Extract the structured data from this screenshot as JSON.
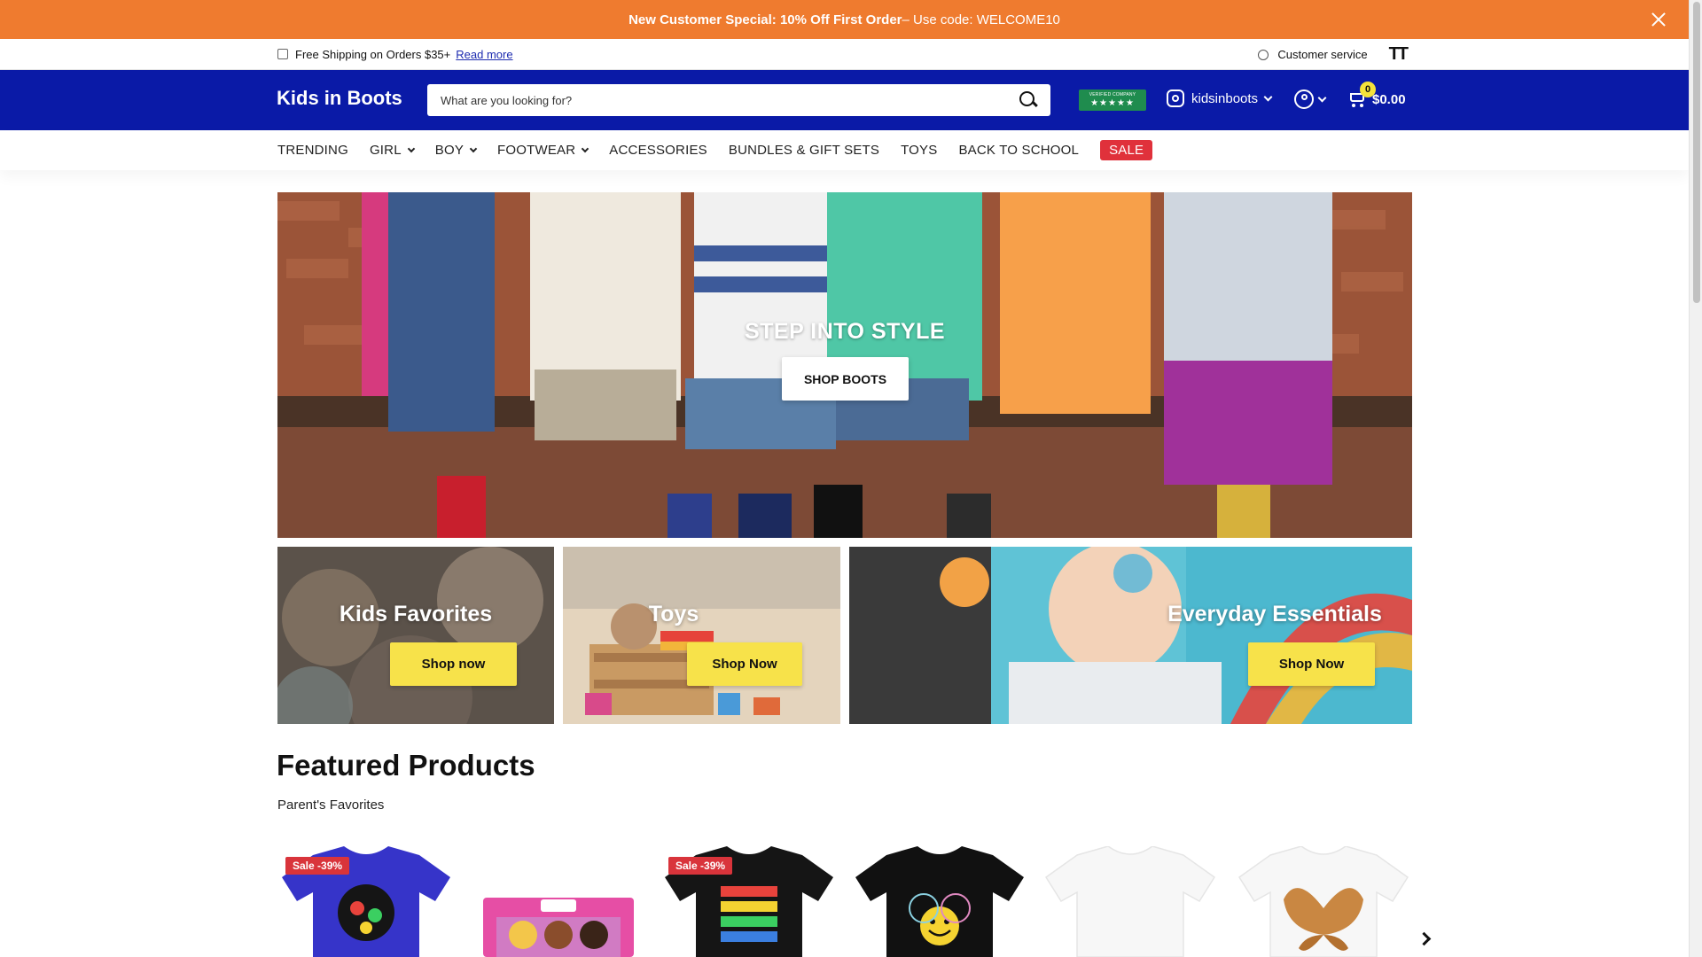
{
  "promo": {
    "bold_text": "New Customer Special: 10% Off First Order",
    "rest_text": "– Use code: WELCOME10"
  },
  "utility": {
    "shipping_text": "Free Shipping on Orders $35+",
    "read_more": "Read more",
    "customer_service": "Customer service",
    "text_size_label": "TT"
  },
  "header": {
    "logo": "Kids in Boots",
    "search_placeholder": "What are you looking for?",
    "trust_badge_top": "VERIFIED COMPANY",
    "trust_badge_stars": "★★★★★",
    "instagram_handle": "kidsinboots",
    "cart_count": "0",
    "cart_total": "$0.00"
  },
  "nav": {
    "items": [
      {
        "label": "TRENDING"
      },
      {
        "label": "GIRL"
      },
      {
        "label": "BOY"
      },
      {
        "label": "FOOTWEAR"
      },
      {
        "label": "ACCESSORIES"
      },
      {
        "label": "BUNDLES & GIFT SETS"
      },
      {
        "label": "TOYS"
      },
      {
        "label": "BACK TO SCHOOL"
      },
      {
        "label": "SALE"
      }
    ]
  },
  "hero": {
    "title": "STEP INTO STYLE",
    "button": "SHOP BOOTS"
  },
  "tiles": [
    {
      "title": "Kids Favorites",
      "button": "Shop now"
    },
    {
      "title": "Toys",
      "button": "Shop Now"
    },
    {
      "title": "Everyday Essentials",
      "button": "Shop Now"
    }
  ],
  "featured": {
    "title": "Featured Products",
    "subtitle": "Parent's Favorites",
    "badges": [
      "Sale -39%",
      "Sale -39%"
    ]
  },
  "colors": {
    "promo_bg": "#ef7b2f",
    "header_bg": "#0a1aa7",
    "sale_red": "#e0313b",
    "cta_yellow": "#f7e24a"
  }
}
